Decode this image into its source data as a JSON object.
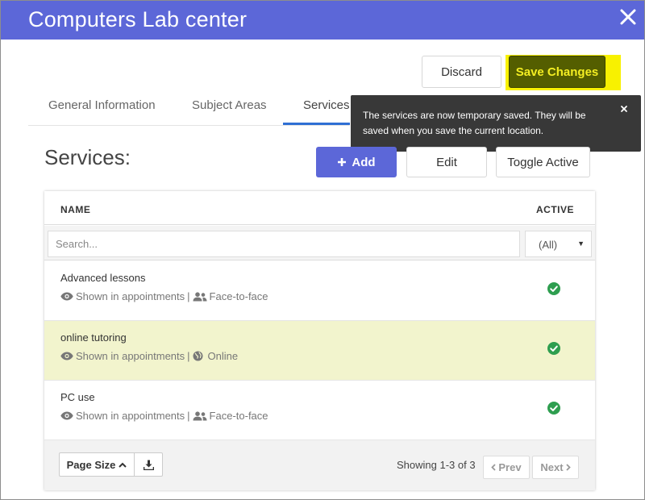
{
  "header": {
    "title": "Computers Lab center"
  },
  "actions": {
    "discard_label": "Discard",
    "save_label": "Save Changes"
  },
  "tabs": [
    {
      "label": "General Information"
    },
    {
      "label": "Subject Areas"
    },
    {
      "label": "Services",
      "active": true
    }
  ],
  "toast": {
    "message": "The services are now temporary saved. They will be saved when you save the current location."
  },
  "services": {
    "title": "Services:",
    "add_label": "Add",
    "edit_label": "Edit",
    "toggle_label": "Toggle Active"
  },
  "table": {
    "columns": [
      "NAME",
      "ACTIVE"
    ],
    "search_placeholder": "Search...",
    "active_filter": "(All)",
    "rows": [
      {
        "name": "Advanced lessons",
        "visibility": "Shown in appointments",
        "separator": "|",
        "mode": "Face-to-face",
        "mode_icon": "users-icon",
        "active": true
      },
      {
        "name": "online tutoring",
        "visibility": "Shown in appointments",
        "separator": "|",
        "mode": "Online",
        "mode_icon": "globe-icon",
        "active": true,
        "highlighted": true
      },
      {
        "name": "PC use",
        "visibility": "Shown in appointments",
        "separator": "|",
        "mode": "Face-to-face",
        "mode_icon": "users-icon",
        "active": true
      }
    ]
  },
  "footer": {
    "page_size_label": "Page Size",
    "showing": "Showing 1-3 of 3",
    "prev_label": "Prev",
    "next_label": "Next"
  },
  "colors": {
    "header": "#5c67d8",
    "save_button": "#545e00",
    "save_highlight": "#f8f100",
    "active_check": "#2e9e4f",
    "highlight_row": "#f2f4cd"
  }
}
